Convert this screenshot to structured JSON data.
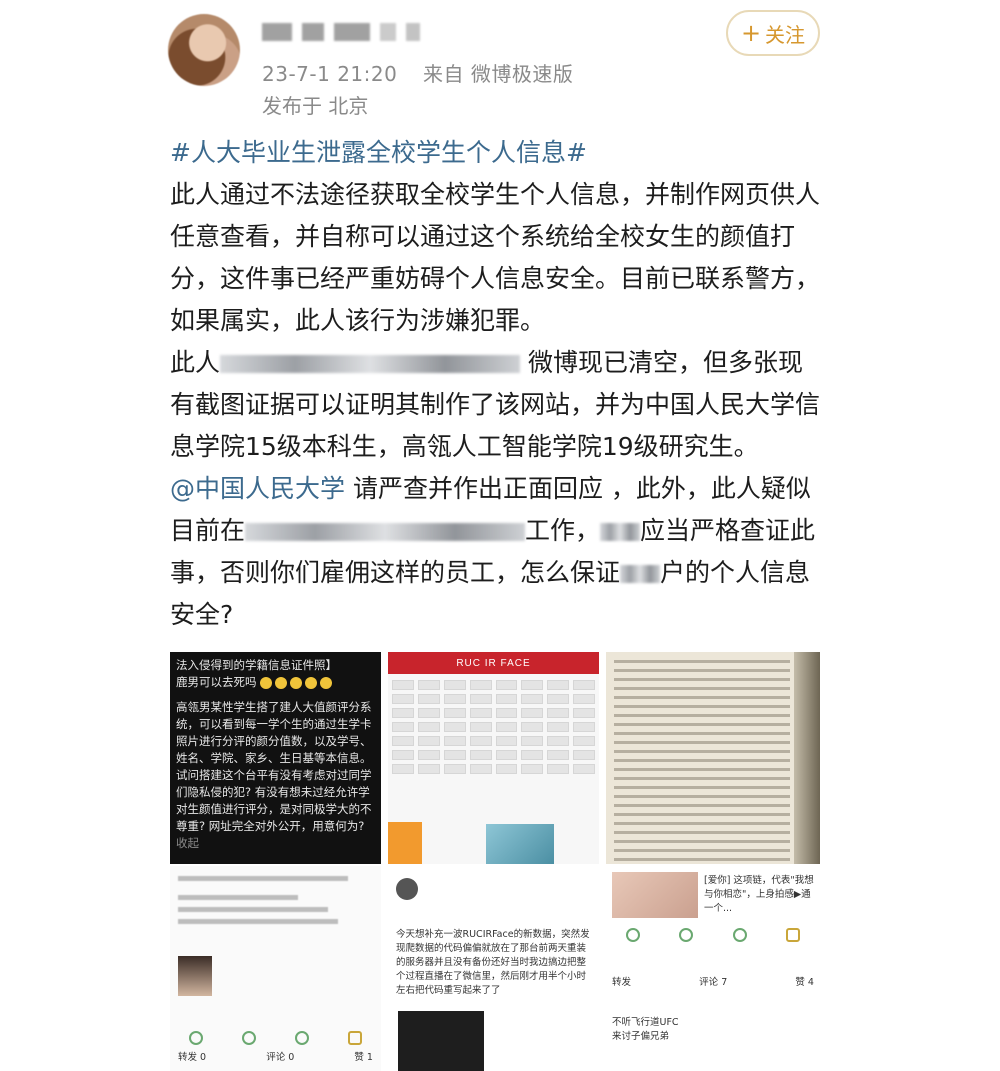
{
  "header": {
    "timestamp": "23-7-1 21:20",
    "source": "来自 微博极速版",
    "location": "发布于 北京",
    "follow_label": "关注",
    "follow_plus": "+"
  },
  "post": {
    "hashtag": "#人大毕业生泄露全校学生个人信息#",
    "para1": "此人通过不法途径获取全校学生个人信息，并制作网页供人任意查看，并自称可以通过这个系统给全校女生的颜值打分，这件事已经严重妨碍个人信息安全。目前已联系警方，如果属实，此人该行为涉嫌犯罪。",
    "para2_start": "此人",
    "para2_rest": "微博现已清空，但多张现有截图证据可以证明其制作了该网站，并为中国人民大学信息学院15级本科生，高瓴人工智能学院19级研究生。",
    "mention": "@中国人民大学",
    "para3_a": " 请严查并作出正面回应 ，此外，此人疑似目前在",
    "para3_b": "工作，",
    "para3_c": "应当严格查证此事，否则你们雇佣这样的员工，怎么保证",
    "para3_d": "户的个人信息安全?"
  },
  "images": {
    "tile1_title": "法入侵得到的学籍信息证件照】",
    "tile1_line2": "鹿男可以去死吗",
    "tile1_body": "高瓴男某性学生搭了建人大值颜评分系统，可以看到每一学个生的通过生学卡照片进行分评的颜分值数，以及学号、姓名、学院、家乡、生日基等本信息。试问搭建这个台平有没有考虑对过同学们隐私侵的犯? 有没有想未过经允许学对生颜值进行评分，是对同极学大的不尊重? 网址完全对外公开，用意何为?",
    "tile1_fold": "收起",
    "tile2_header": "RUC IR FACE",
    "tile5_body": "今天想补充一波RUCIRFace的新数据，突然发现爬数据的代码偏偏就放在了那台前两天重装的服务器并且没有备份",
    "tile5_body2": "还好当时我边搞边把整个过程直播在了微信里，然后刚才用半个小时左右把代码重写起来了了",
    "tile6_text": "[爱你] 这项链，代表\"我想与你相恋\"，上身拍感▶通一个...",
    "tile6_comment_tab": "评论 7",
    "tile6_forward": "转发",
    "tile4_forward": "转发 0",
    "tile4_comment": "评论 0",
    "tile4_like": "赞 1",
    "tile6_likes": "赞 4",
    "tile6_reply": "来讨子偏兄弟",
    "tile6_reply_head": "不听飞行道UFC"
  }
}
